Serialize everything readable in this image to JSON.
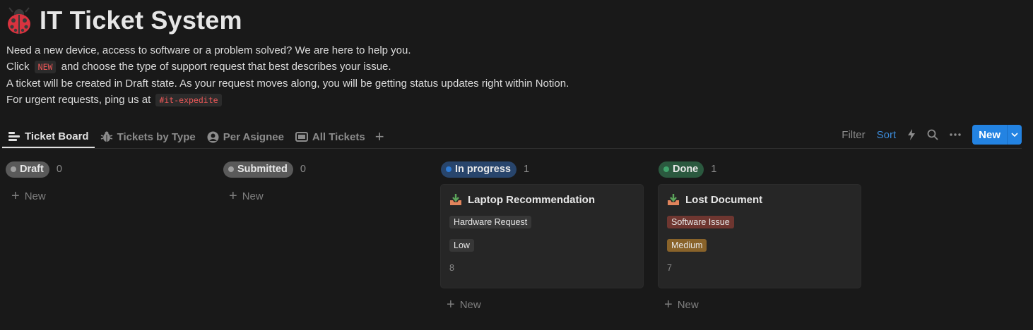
{
  "page": {
    "title": "IT Ticket System",
    "icon": "ladybug-icon"
  },
  "description": {
    "line1": "Need a new device, access to software or a problem solved? We are here to help you.",
    "line2_before": "Click ",
    "line2_code": "NEW",
    "line2_after": " and choose the type of support request that best describes your issue.",
    "line3": "A ticket will be created in Draft state. As your request moves along, you will be getting status updates right within Notion.",
    "line4_before": "For urgent requests, ping us at ",
    "line4_code": "#it-expedite"
  },
  "tabs": [
    {
      "label": "Ticket Board",
      "icon": "board-icon",
      "active": true
    },
    {
      "label": "Tickets by Type",
      "icon": "bug-icon",
      "active": false
    },
    {
      "label": "Per Asignee",
      "icon": "person-icon",
      "active": false
    },
    {
      "label": "All Tickets",
      "icon": "table-icon",
      "active": false
    }
  ],
  "toolbar": {
    "filter": "Filter",
    "sort": "Sort",
    "new": "New"
  },
  "colors": {
    "accent": "#2383e2",
    "draft": "#5a5a5a",
    "submitted": "#5a5a5a",
    "in_progress": "#28456c",
    "done": "#2b593f",
    "software_issue_tag": "#6e3630",
    "medium_tag": "#89632a",
    "neutral_tag": "#373737"
  },
  "board": {
    "add_label": "New",
    "columns": [
      {
        "name": "Draft",
        "count": "0"
      },
      {
        "name": "Submitted",
        "count": "0"
      },
      {
        "name": "In progress",
        "count": "1",
        "card": {
          "title": "Laptop Recommendation",
          "type": "Hardware Request",
          "priority": "Low",
          "number": "8"
        }
      },
      {
        "name": "Done",
        "count": "1",
        "card": {
          "title": "Lost Document",
          "type": "Software Issue",
          "priority": "Medium",
          "number": "7"
        }
      }
    ]
  }
}
